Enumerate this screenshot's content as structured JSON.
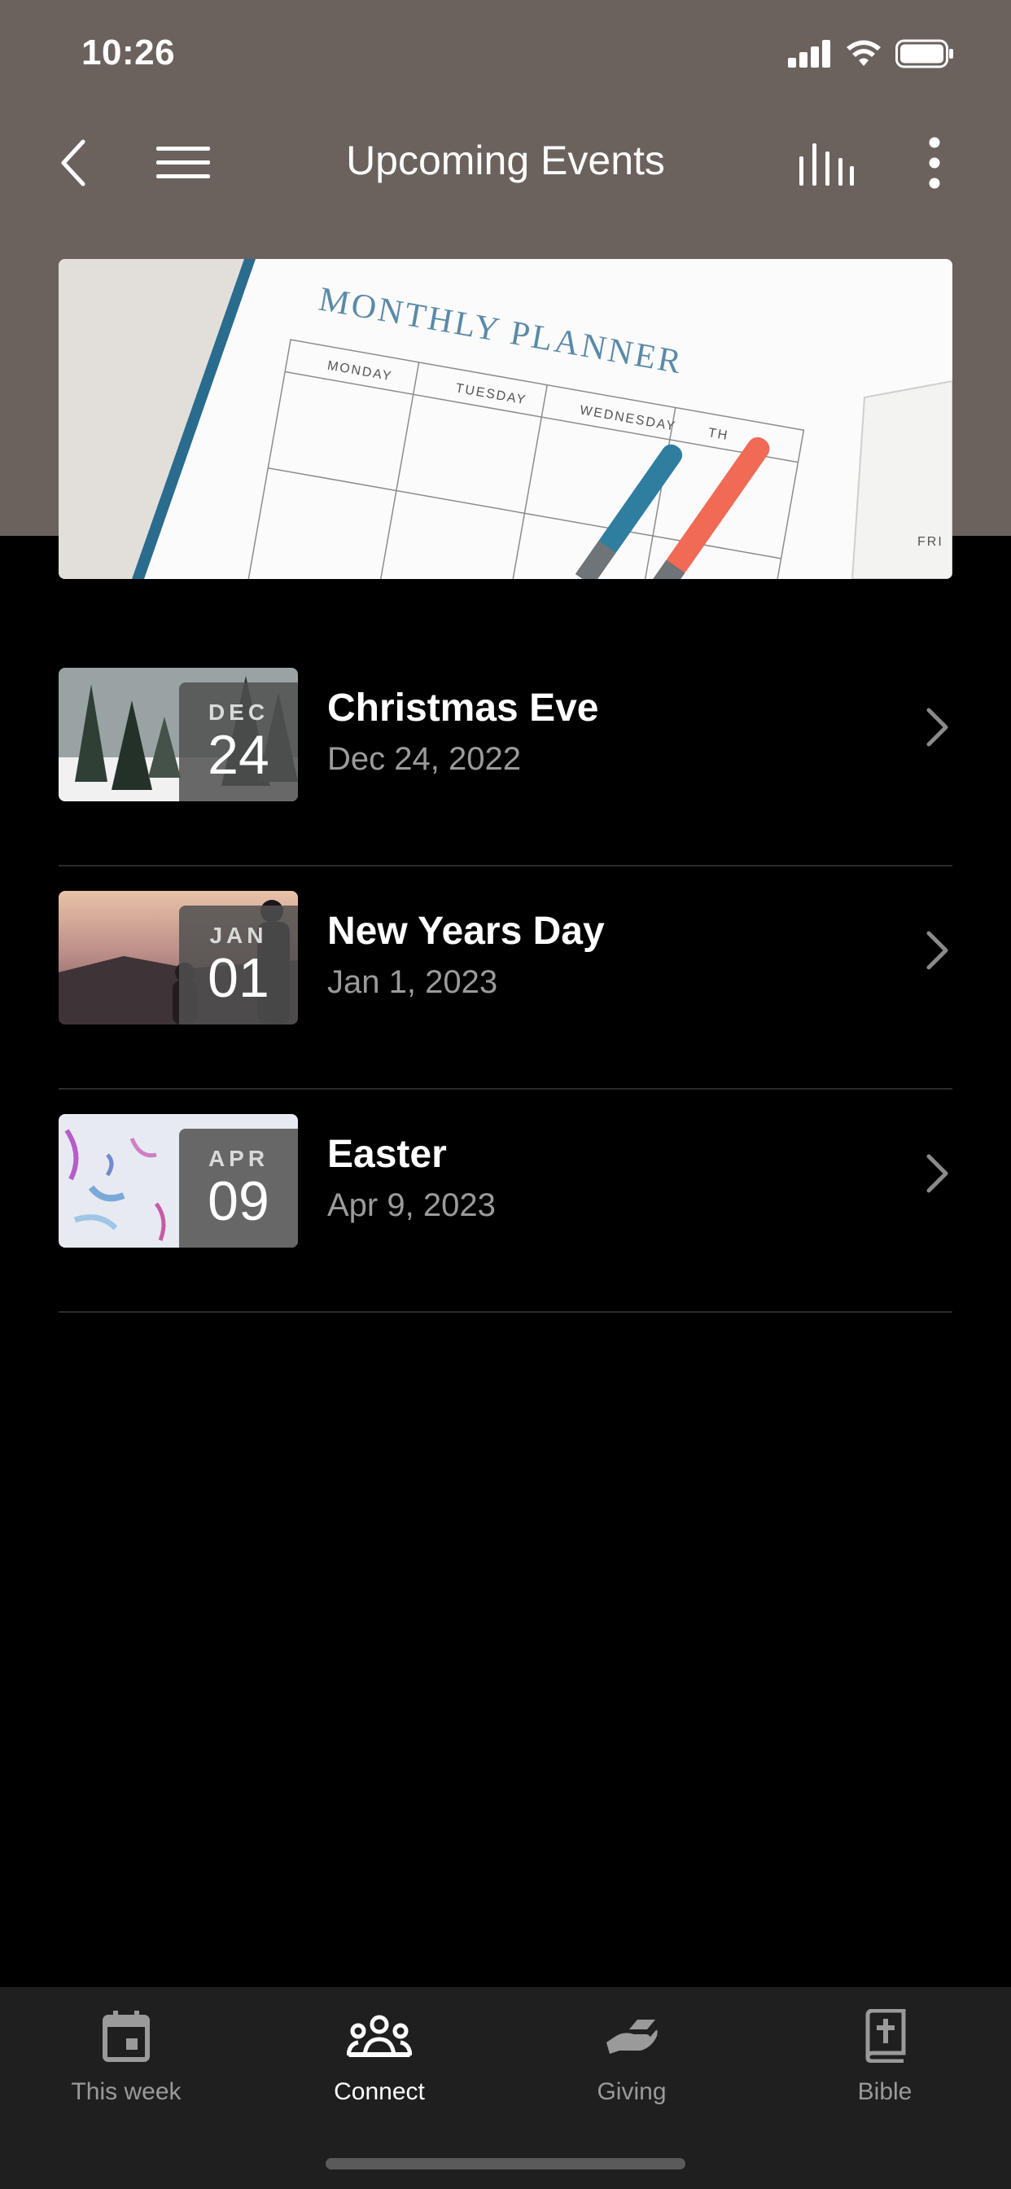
{
  "status_bar": {
    "time": "10:26"
  },
  "header": {
    "title": "Upcoming Events"
  },
  "hero": {
    "planner_title": "MONTHLY PLANNER",
    "days": [
      "MONDAY",
      "TUESDAY",
      "WEDNESDAY",
      "TH",
      "FRI"
    ]
  },
  "events": [
    {
      "title": "Christmas Eve",
      "date": "Dec 24, 2022",
      "month": "DEC",
      "day": "24"
    },
    {
      "title": "New Years Day",
      "date": "Jan 1, 2023",
      "month": "JAN",
      "day": "01"
    },
    {
      "title": "Easter",
      "date": "Apr 9, 2023",
      "month": "APR",
      "day": "09"
    }
  ],
  "tabs": [
    {
      "label": "This week",
      "icon": "calendar-icon"
    },
    {
      "label": "Connect",
      "icon": "people-icon",
      "active": true
    },
    {
      "label": "Giving",
      "icon": "giving-hand-icon"
    },
    {
      "label": "Bible",
      "icon": "bible-icon"
    }
  ],
  "colors": {
    "header_bg": "#6b625e",
    "background": "#000000",
    "tab_bar_bg": "#1f1f1f",
    "secondary_text": "#9b9b9b"
  }
}
